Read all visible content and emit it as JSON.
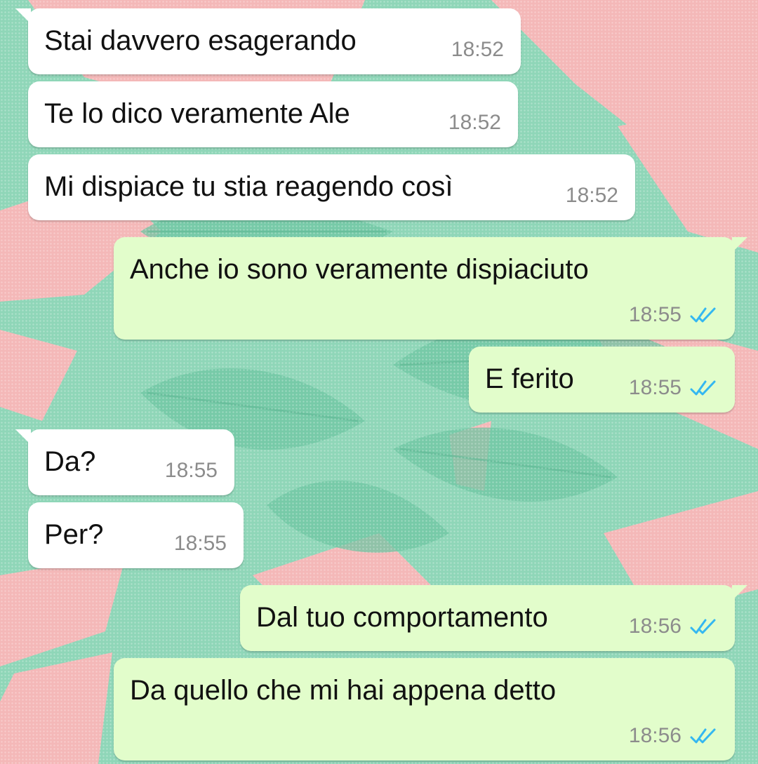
{
  "colors": {
    "wallpaper_green": "#8fd6b8",
    "wallpaper_pink": "#f4b8b8",
    "incoming_bubble": "#ffffff",
    "outgoing_bubble": "#e2fdcb",
    "read_ticks": "#34b7f1",
    "timestamp": "#8c8c8c"
  },
  "messages": [
    {
      "direction": "incoming",
      "text": "Stai davvero esagerando",
      "time": "18:52"
    },
    {
      "direction": "incoming",
      "text": "Te lo dico veramente Ale",
      "time": "18:52"
    },
    {
      "direction": "incoming",
      "text": "Mi dispiace tu stia reagendo così",
      "time": "18:52"
    },
    {
      "direction": "outgoing",
      "text": "Anche io sono veramente dispiaciuto",
      "time": "18:55",
      "status_icon": "double-check-read"
    },
    {
      "direction": "outgoing",
      "text": "E ferito",
      "time": "18:55",
      "status_icon": "double-check-read"
    },
    {
      "direction": "incoming",
      "text": "Da?",
      "time": "18:55"
    },
    {
      "direction": "incoming",
      "text": "Per?",
      "time": "18:55"
    },
    {
      "direction": "outgoing",
      "text": "Dal tuo comportamento",
      "time": "18:56",
      "status_icon": "double-check-read"
    },
    {
      "direction": "outgoing",
      "text": "Da quello che mi hai appena detto",
      "time": "18:56",
      "status_icon": "double-check-read"
    }
  ]
}
